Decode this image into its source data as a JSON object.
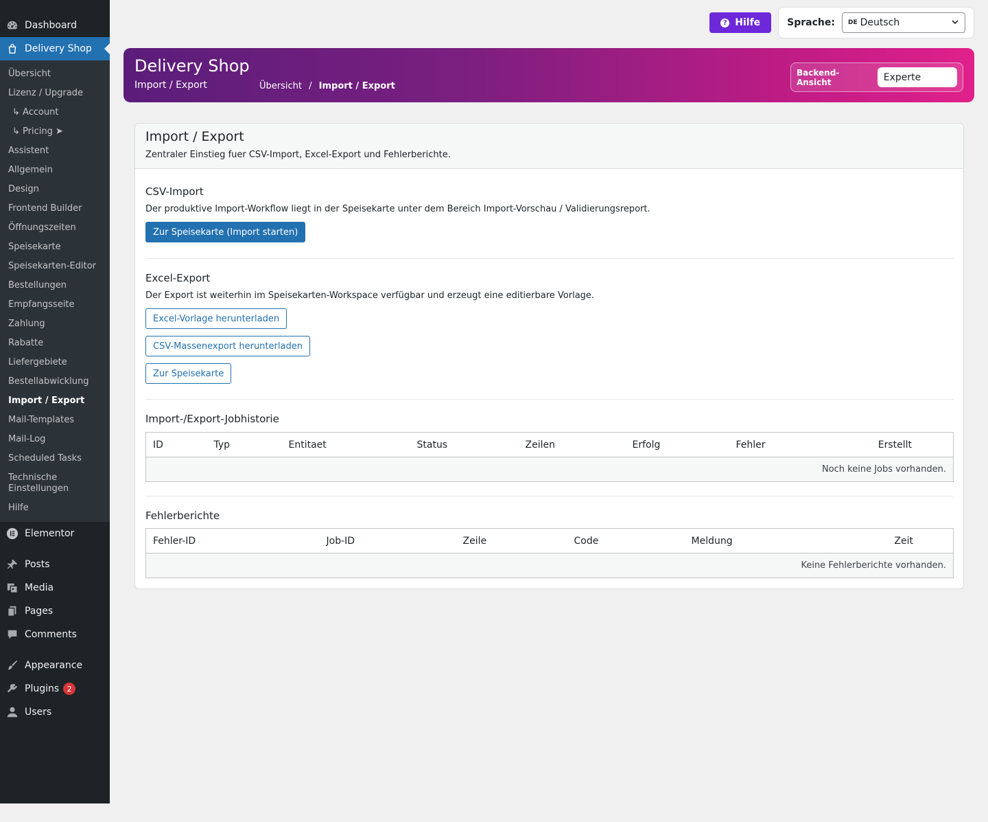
{
  "sidebar": {
    "top_items": [
      {
        "label": "Dashboard",
        "icon": "dashboard-icon"
      },
      {
        "label": "Delivery Shop",
        "icon": "shop-bag-icon"
      }
    ],
    "submenu": [
      "Übersicht",
      "Lizenz / Upgrade",
      "↳ Account",
      "↳ Pricing ➤",
      "Assistent",
      "Allgemein",
      "Design",
      "Frontend Builder",
      "Öffnungszeiten",
      "Speisekarte",
      "Speisekarten-Editor",
      "Bestellungen",
      "Empfangsseite",
      "Zahlung",
      "Rabatte",
      "Liefergebiete",
      "Bestellabwicklung",
      "Import / Export",
      "Mail-Templates",
      "Mail-Log",
      "Scheduled Tasks",
      "Technische Einstellungen",
      "Hilfe"
    ],
    "bottom_items": [
      {
        "label": "Elementor",
        "icon": "elementor-icon"
      },
      {
        "label": "Posts",
        "icon": "pin-icon"
      },
      {
        "label": "Media",
        "icon": "media-icon"
      },
      {
        "label": "Pages",
        "icon": "pages-icon"
      },
      {
        "label": "Comments",
        "icon": "comment-icon"
      },
      {
        "label": "Appearance",
        "icon": "brush-icon"
      },
      {
        "label": "Plugins",
        "icon": "plugin-icon",
        "badge": "2"
      },
      {
        "label": "Users",
        "icon": "user-icon"
      }
    ]
  },
  "topbar": {
    "help_label": "Hilfe",
    "language_label": "Sprache:",
    "language_flag": "DE",
    "language_value": "Deutsch"
  },
  "banner": {
    "title": "Delivery Shop",
    "subtitle": "Import / Export",
    "breadcrumb_parent": "Übersicht",
    "breadcrumb_sep": "/",
    "breadcrumb_current": "Import / Export",
    "view_label": "Backend-Ansicht",
    "view_value": "Experte"
  },
  "card": {
    "title": "Import / Export",
    "description": "Zentraler Einstieg fuer CSV-Import, Excel-Export und Fehlerberichte.",
    "csv": {
      "title": "CSV-Import",
      "description": "Der produktive Import-Workflow liegt in der Speisekarte unter dem Bereich Import-Vorschau / Validierungsreport.",
      "button": "Zur Speisekarte (Import starten)"
    },
    "excel": {
      "title": "Excel-Export",
      "description": "Der Export ist weiterhin im Speisekarten-Workspace verfügbar und erzeugt eine editierbare Vorlage.",
      "buttons": [
        "Excel-Vorlage herunterladen",
        "CSV-Massenexport herunterladen",
        "Zur Speisekarte"
      ]
    },
    "jobs": {
      "title": "Import-/Export-Jobhistorie",
      "columns": [
        "ID",
        "Typ",
        "Entitaet",
        "Status",
        "Zeilen",
        "Erfolg",
        "Fehler",
        "Erstellt"
      ],
      "empty": "Noch keine Jobs vorhanden."
    },
    "errors": {
      "title": "Fehlerberichte",
      "columns": [
        "Fehler-ID",
        "Job-ID",
        "Zeile",
        "Code",
        "Meldung",
        "Zeit"
      ],
      "empty": "Keine Fehlerberichte vorhanden."
    }
  },
  "colors": {
    "sidebar_bg": "#1d2327",
    "accent_blue": "#2271b1",
    "help_purple": "#6d28d9",
    "banner_gradient_start": "#5b1d7a",
    "banner_gradient_end": "#e0208a"
  }
}
